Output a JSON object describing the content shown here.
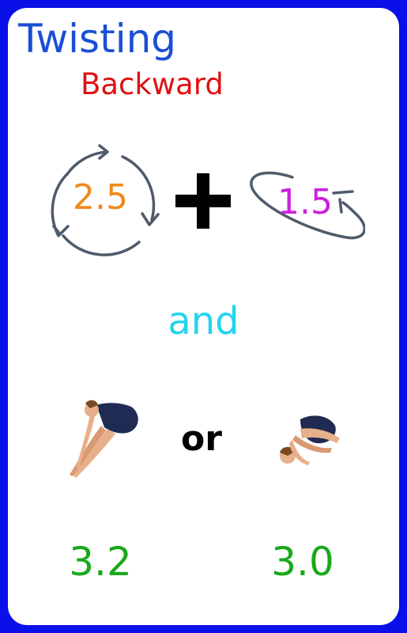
{
  "card": {
    "title": "Twisting",
    "subtitle": "Backward"
  },
  "rotations": {
    "somersault_icon": "circular-arrows-icon",
    "somersaults": "2.5",
    "somersault_color": "#f08a1c",
    "operator_icon": "plus-icon",
    "twist_icon": "twist-loop-icon",
    "twists": "1.5",
    "twist_color": "#cc22dd"
  },
  "connector": "and",
  "positions": {
    "separator": "or",
    "options": [
      {
        "figure": "pike-diver-figure",
        "dd": "3.2"
      },
      {
        "figure": "tuck-diver-figure",
        "dd": "3.0"
      }
    ],
    "dd_color": "#1aa81a"
  },
  "colors": {
    "frame": "#0a10e8",
    "title": "#1a4fd6",
    "subtitle": "#e01010",
    "connector": "#22d4f0"
  }
}
